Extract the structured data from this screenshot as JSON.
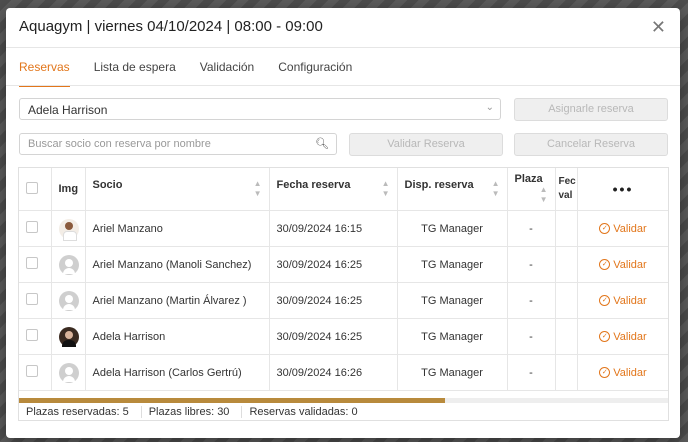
{
  "title": "Aquagym | viernes 04/10/2024 | 08:00 - 09:00",
  "tabs": [
    {
      "label": "Reservas"
    },
    {
      "label": "Lista de espera"
    },
    {
      "label": "Validación"
    },
    {
      "label": "Configuración"
    }
  ],
  "member_select": {
    "value": "Adela Harrison"
  },
  "assign_button": "Asignarle reserva",
  "search": {
    "placeholder": "Buscar socio con reserva por nombre"
  },
  "validate_button": "Validar Reserva",
  "cancel_button": "Cancelar Reserva",
  "table": {
    "headers": {
      "img": "Img",
      "socio": "Socio",
      "fecha": "Fecha reserva",
      "disp": "Disp. reserva",
      "plaza": "Plaza",
      "fecha_val": "Fec val",
      "more": "•••"
    },
    "rows": [
      {
        "avatar": "photo-man",
        "socio": "Ariel Manzano",
        "fecha": "30/09/2024 16:15",
        "disp": "TG Manager",
        "plaza": "-",
        "action": "Validar"
      },
      {
        "avatar": "default-avatar",
        "socio": "Ariel Manzano (Manoli Sanchez)",
        "fecha": "30/09/2024 16:25",
        "disp": "TG Manager",
        "plaza": "-",
        "action": "Validar"
      },
      {
        "avatar": "default-avatar",
        "socio": "Ariel Manzano (Martin Álvarez )",
        "fecha": "30/09/2024 16:25",
        "disp": "TG Manager",
        "plaza": "-",
        "action": "Validar"
      },
      {
        "avatar": "photo-woman",
        "socio": "Adela Harrison",
        "fecha": "30/09/2024 16:25",
        "disp": "TG Manager",
        "plaza": "-",
        "action": "Validar"
      },
      {
        "avatar": "default-avatar",
        "socio": "Adela Harrison (Carlos Gertrú)",
        "fecha": "30/09/2024 16:26",
        "disp": "TG Manager",
        "plaza": "-",
        "action": "Validar"
      }
    ]
  },
  "footer": {
    "reserved": "Plazas reservadas: 5",
    "free": "Plazas libres: 30",
    "validated": "Reservas validadas: 0"
  },
  "colors": {
    "accent": "#e2761b"
  }
}
